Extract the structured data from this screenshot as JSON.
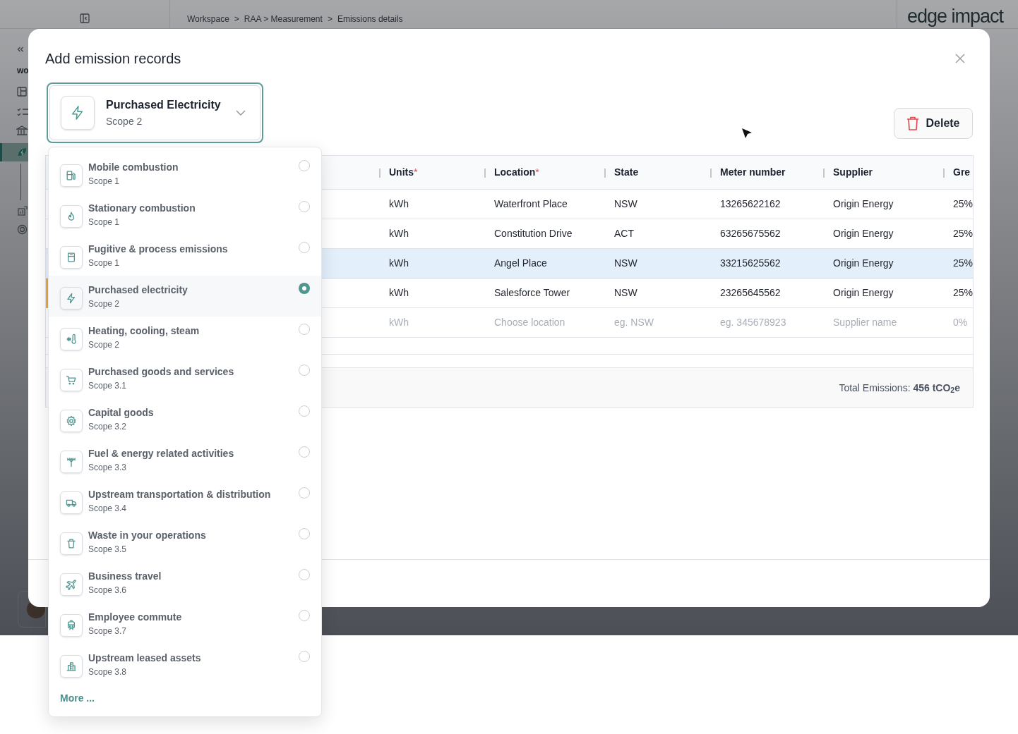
{
  "topbar": {
    "breadcrumb": [
      "Workspace",
      ">",
      "RAA > Measurement",
      ">",
      "Emissions details"
    ],
    "logo": "edge impact"
  },
  "sidebar": {
    "heading": "wo"
  },
  "modal": {
    "title": "Add emission records",
    "selector": {
      "title": "Purchased Electricity",
      "subtitle": "Scope 2",
      "expanded": true
    },
    "delete_button": "Delete",
    "table": {
      "columns": [
        {
          "label": "Units",
          "required_mark": "*"
        },
        {
          "label": "Location",
          "required_mark": "*"
        },
        {
          "label": "State"
        },
        {
          "label": "Meter number"
        },
        {
          "label": "Supplier"
        },
        {
          "label": "Gre"
        }
      ],
      "rows": [
        {
          "cells": [
            "kWh",
            "Waterfront Place",
            "NSW",
            "13265622162",
            "Origin Energy",
            "25%"
          ],
          "selected": false,
          "flagged": false,
          "placeholder": false
        },
        {
          "cells": [
            "kWh",
            "Constitution Drive",
            "ACT",
            "63265675562",
            "Origin Energy",
            "25%"
          ],
          "selected": false,
          "flagged": false,
          "placeholder": false
        },
        {
          "cells": [
            "kWh",
            "Angel Place",
            "NSW",
            "33215625562",
            "Origin Energy",
            "25%"
          ],
          "selected": true,
          "flagged": false,
          "placeholder": false
        },
        {
          "cells": [
            "kWh",
            "Salesforce Tower",
            "NSW",
            "23265645562",
            "Origin Energy",
            "25%"
          ],
          "selected": false,
          "flagged": true,
          "placeholder": false
        },
        {
          "cells": [
            "kWh",
            "Choose location",
            "eg. NSW",
            "eg. 345678923",
            "Supplier name",
            "0%"
          ],
          "selected": false,
          "flagged": false,
          "placeholder": true
        }
      ],
      "total": "Total Emissions: **456 tCO$_{2}$e**"
    }
  },
  "dropdown": {
    "items": [
      {
        "title": "Mobile combustion",
        "scope": "Scope 1",
        "selected": false
      },
      {
        "title": "Stationary combustion",
        "scope": "Scope 1",
        "selected": false
      },
      {
        "title": "Fugitive & process emissions",
        "scope": "Scope 1",
        "selected": false
      },
      {
        "title": "Purchased electricity",
        "scope": "Scope 2",
        "selected": true
      },
      {
        "title": "Heating, cooling, steam",
        "scope": "Scope 2",
        "selected": false
      },
      {
        "title": "Purchased goods and services",
        "scope": "Scope 3.1",
        "selected": false
      },
      {
        "title": "Capital goods",
        "scope": "Scope 3.2",
        "selected": false
      },
      {
        "title": "Fuel & energy related activities",
        "scope": "Scope 3.3",
        "selected": false
      },
      {
        "title": "Upstream transportation & distribution",
        "scope": "Scope 3.4",
        "selected": false
      },
      {
        "title": "Waste in your operations",
        "scope": "Scope 3.5",
        "selected": false
      },
      {
        "title": "Business travel",
        "scope": "Scope 3.6",
        "selected": false
      },
      {
        "title": "Employee commute",
        "scope": "Scope 3.7",
        "selected": false
      },
      {
        "title": "Upstream leased assets",
        "scope": "Scope 3.8",
        "selected": false
      }
    ],
    "more_link": "More ..."
  }
}
